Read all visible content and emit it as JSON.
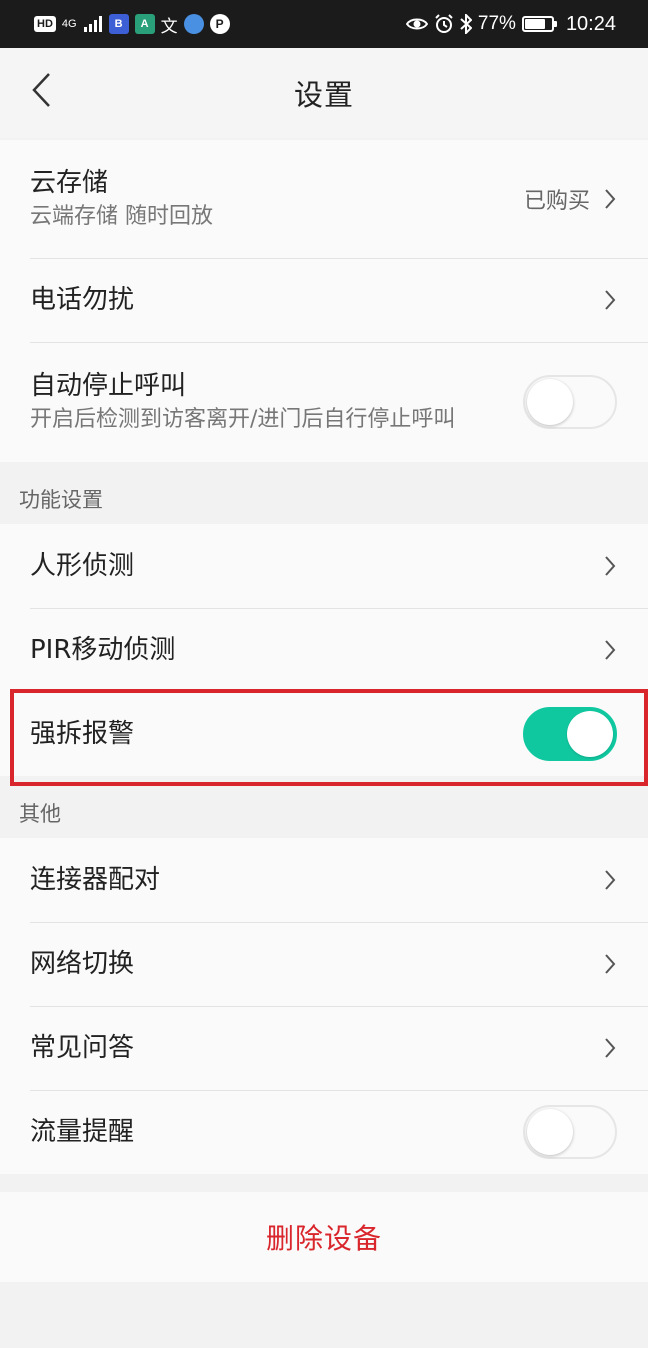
{
  "status_bar": {
    "hd_badge": "HD",
    "signal": "4G",
    "app_badge_1": "B",
    "app_badge_2": "A",
    "app_icon_3": "文",
    "p_badge": "P",
    "battery_percent": "77%",
    "battery_level": 0.77,
    "time": "10:24"
  },
  "nav": {
    "title": "设置"
  },
  "rows": {
    "cloud": {
      "title": "云存储",
      "subtitle": "云端存储 随时回放",
      "value": "已购买"
    },
    "dnd": {
      "title": "电话勿扰"
    },
    "auto_stop": {
      "title": "自动停止呼叫",
      "subtitle": "开启后检测到访客离开/进门后自行停止呼叫",
      "on": false
    },
    "human_detect": {
      "title": "人形侦测"
    },
    "pir": {
      "title": "PIR移动侦测"
    },
    "tamper_alarm": {
      "title": "强拆报警",
      "on": true
    },
    "pairing": {
      "title": "连接器配对"
    },
    "network": {
      "title": "网络切换"
    },
    "faq": {
      "title": "常见问答"
    },
    "traffic": {
      "title": "流量提醒",
      "on": false
    }
  },
  "sections": {
    "features": "功能设置",
    "other": "其他"
  },
  "delete": {
    "label": "删除设备"
  },
  "colors": {
    "accent_toggle": "#10c8a0",
    "danger": "#d9262c",
    "highlight_border": "#d9262c"
  }
}
